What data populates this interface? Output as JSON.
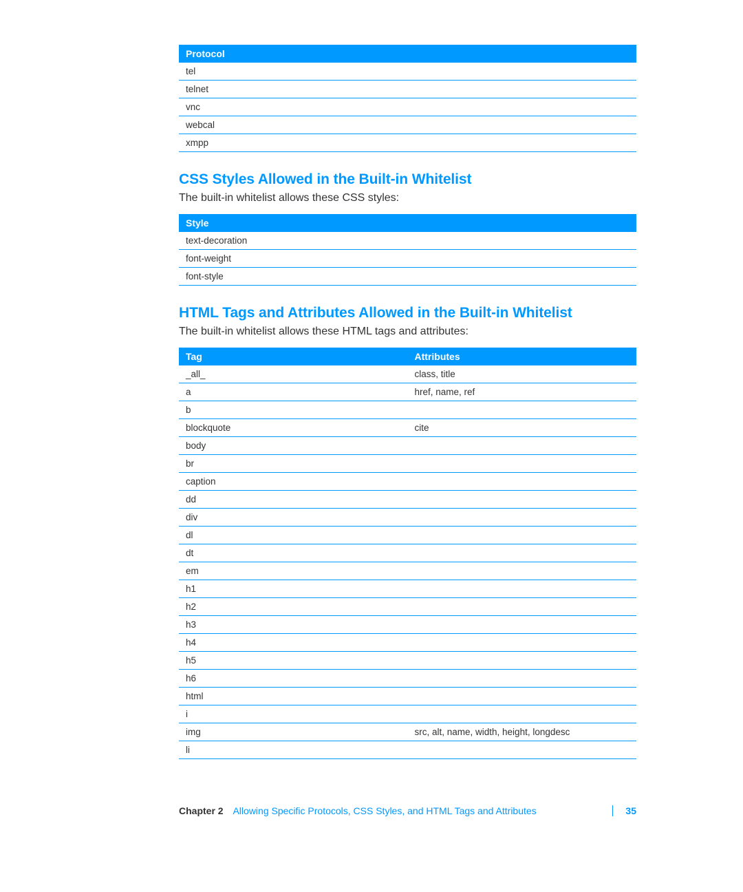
{
  "protocol_table": {
    "header": "Protocol",
    "rows": [
      "tel",
      "telnet",
      "vnc",
      "webcal",
      "xmpp"
    ]
  },
  "css_section": {
    "heading": "CSS Styles Allowed in the Built-in Whitelist",
    "lead": "The built-in whitelist allows these CSS styles:",
    "header": "Style",
    "rows": [
      "text-decoration",
      "font-weight",
      "font-style"
    ]
  },
  "html_section": {
    "heading": "HTML Tags and Attributes Allowed in the Built-in Whitelist",
    "lead": "The built-in whitelist allows these HTML tags and attributes:",
    "header_tag": "Tag",
    "header_attr": "Attributes",
    "rows": [
      {
        "tag": "_all_",
        "attr": "class, title"
      },
      {
        "tag": "a",
        "attr": "href, name, ref"
      },
      {
        "tag": "b",
        "attr": ""
      },
      {
        "tag": "blockquote",
        "attr": "cite"
      },
      {
        "tag": "body",
        "attr": ""
      },
      {
        "tag": "br",
        "attr": ""
      },
      {
        "tag": "caption",
        "attr": ""
      },
      {
        "tag": "dd",
        "attr": ""
      },
      {
        "tag": "div",
        "attr": ""
      },
      {
        "tag": "dl",
        "attr": ""
      },
      {
        "tag": "dt",
        "attr": ""
      },
      {
        "tag": "em",
        "attr": ""
      },
      {
        "tag": "h1",
        "attr": ""
      },
      {
        "tag": "h2",
        "attr": ""
      },
      {
        "tag": "h3",
        "attr": ""
      },
      {
        "tag": "h4",
        "attr": ""
      },
      {
        "tag": "h5",
        "attr": ""
      },
      {
        "tag": "h6",
        "attr": ""
      },
      {
        "tag": "html",
        "attr": ""
      },
      {
        "tag": "i",
        "attr": ""
      },
      {
        "tag": "img",
        "attr": "src, alt, name, width, height, longdesc"
      },
      {
        "tag": "li",
        "attr": ""
      }
    ]
  },
  "footer": {
    "chapter_label": "Chapter 2",
    "chapter_title": "Allowing Specific Protocols, CSS Styles, and HTML Tags and Attributes",
    "page_number": "35"
  }
}
